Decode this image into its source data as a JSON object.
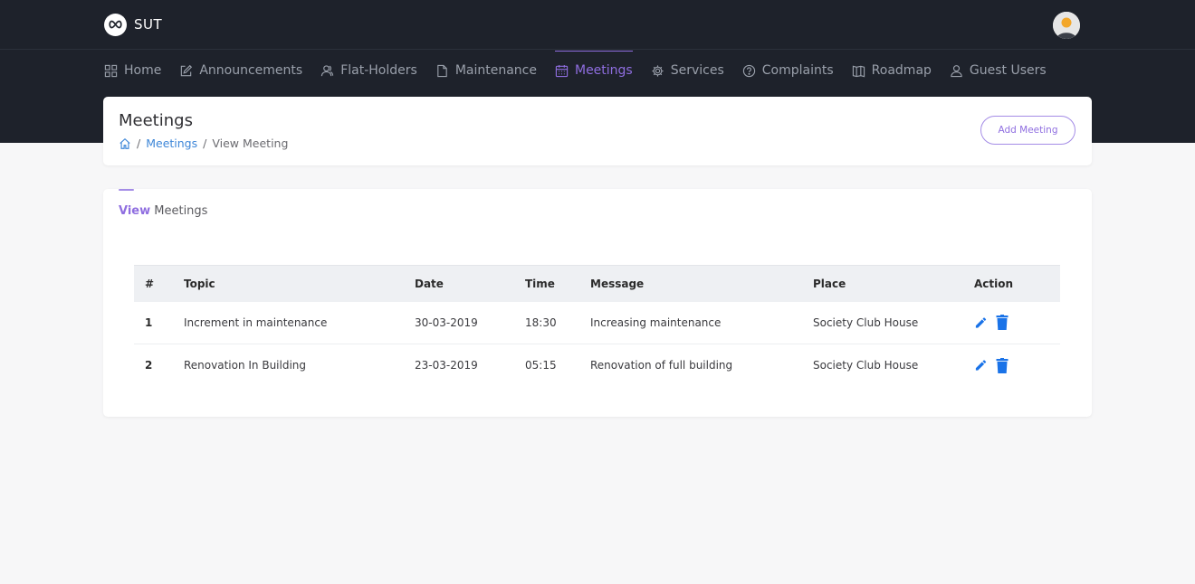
{
  "app": {
    "name": "SUT"
  },
  "nav": [
    {
      "label": "Home",
      "icon": "grid-icon"
    },
    {
      "label": "Announcements",
      "icon": "edit-icon"
    },
    {
      "label": "Flat-Holders",
      "icon": "users-icon"
    },
    {
      "label": "Maintenance",
      "icon": "file-icon"
    },
    {
      "label": "Meetings",
      "icon": "calendar-icon",
      "active": true
    },
    {
      "label": "Services",
      "icon": "gear-icon"
    },
    {
      "label": "Complaints",
      "icon": "help-circle-icon"
    },
    {
      "label": "Roadmap",
      "icon": "map-icon"
    },
    {
      "label": "Guest Users",
      "icon": "user-icon"
    }
  ],
  "header": {
    "title": "Meetings",
    "breadcrumb": {
      "link": "Meetings",
      "current": "View Meeting"
    },
    "add_button": "Add Meeting"
  },
  "card": {
    "title_strong": "View",
    "title_rest": " Meetings"
  },
  "table": {
    "columns": [
      "#",
      "Topic",
      "Date",
      "Time",
      "Message",
      "Place",
      "Action"
    ],
    "rows": [
      {
        "num": "1",
        "topic": "Increment in maintenance",
        "date": "30-03-2019",
        "time": "18:30",
        "message": "Increasing maintenance",
        "place": "Society Club House"
      },
      {
        "num": "2",
        "topic": "Renovation In Building",
        "date": "23-03-2019",
        "time": "05:15",
        "message": "Renovation of full building",
        "place": "Society Club House"
      }
    ]
  },
  "colors": {
    "accent": "#8f6ee0",
    "link": "#3d86d8",
    "action_icon": "#1a73e8",
    "dark_bg": "#1e222b"
  }
}
